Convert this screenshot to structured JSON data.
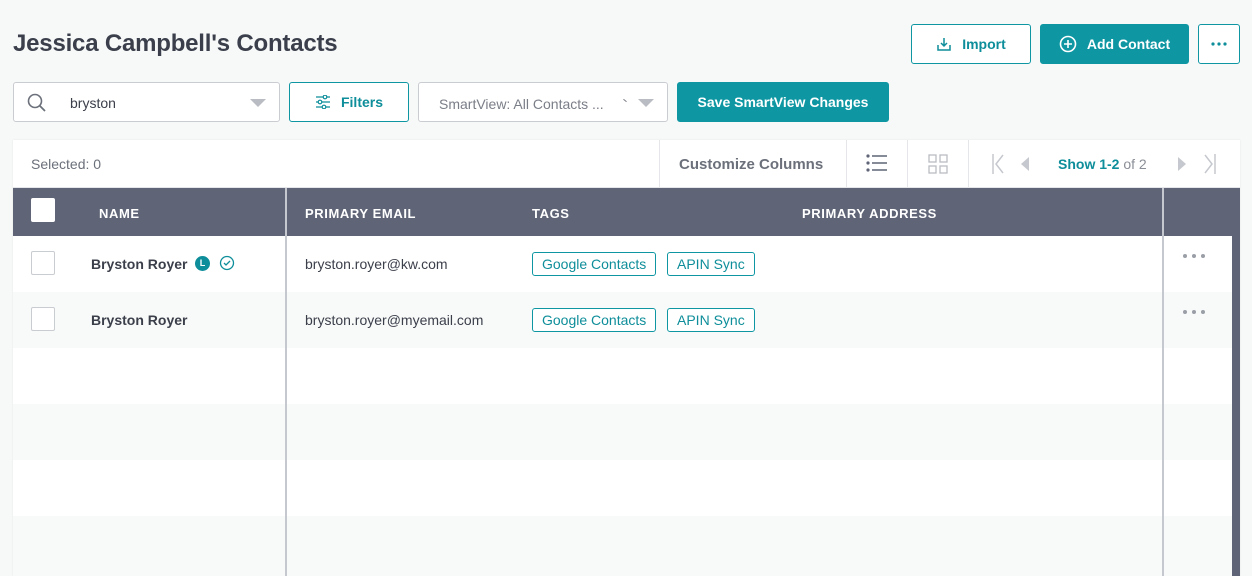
{
  "page": {
    "title": "Jessica Campbell's Contacts"
  },
  "header": {
    "import_label": "Import",
    "add_contact_label": "Add Contact"
  },
  "search": {
    "value": "bryston"
  },
  "filters": {
    "label": "Filters"
  },
  "smartview": {
    "selected": "SmartView: All Contacts ...",
    "save_label": "Save SmartView Changes"
  },
  "toolbar": {
    "selected_label": "Selected: 0",
    "customize_label": "Customize Columns",
    "pager_range": "Show 1-2",
    "pager_total": "of 2"
  },
  "table": {
    "columns": [
      "NAME",
      "PRIMARY EMAIL",
      "TAGS",
      "PRIMARY ADDRESS"
    ],
    "rows": [
      {
        "name": "Bryston Royer",
        "badge": "L",
        "verified": true,
        "email": "bryston.royer@kw.com",
        "tags": [
          "Google Contacts",
          "APIN Sync"
        ]
      },
      {
        "name": "Bryston Royer",
        "email": "bryston.royer@myemail.com",
        "tags": [
          "Google Contacts",
          "APIN Sync"
        ]
      }
    ]
  },
  "colors": {
    "accent": "#0e97a3",
    "table_header": "#5f6577"
  }
}
